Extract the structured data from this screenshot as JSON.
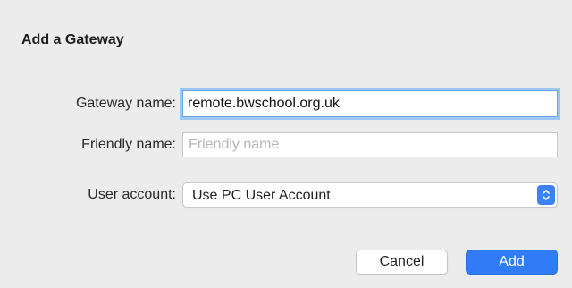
{
  "dialog": {
    "title": "Add a Gateway"
  },
  "form": {
    "gateway_name": {
      "label": "Gateway name:",
      "value": "remote.bwschool.org.uk"
    },
    "friendly_name": {
      "label": "Friendly name:",
      "value": "",
      "placeholder": "Friendly name"
    },
    "user_account": {
      "label": "User account:",
      "selected": "Use PC User Account"
    }
  },
  "buttons": {
    "cancel_label": "Cancel",
    "add_label": "Add"
  },
  "icons": {
    "select_arrow": "chevron-up-down-icon"
  },
  "colors": {
    "accent": "#2f7cf6",
    "focus_ring": "#9fc7f3",
    "background": "#ececec"
  }
}
